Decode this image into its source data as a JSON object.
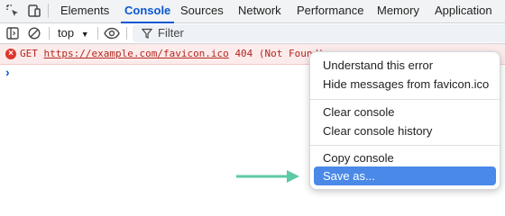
{
  "devtools": {
    "tabs": [
      {
        "label": "Elements"
      },
      {
        "label": "Console"
      },
      {
        "label": "Sources"
      },
      {
        "label": "Network"
      },
      {
        "label": "Performance"
      },
      {
        "label": "Memory"
      },
      {
        "label": "Application"
      }
    ],
    "active_tab": "Console",
    "accent_color": "#0b57d0"
  },
  "toolbar": {
    "context_label": "top",
    "filter_placeholder": "Filter"
  },
  "console": {
    "error": {
      "method": "GET",
      "url": "https://example.com/favicon.ico",
      "status": "404 (Not Found)"
    },
    "prompt": "›"
  },
  "context_menu": {
    "items": [
      {
        "label": "Understand this error"
      },
      {
        "label": "Hide messages from favicon.ico"
      },
      {
        "label": "Clear console"
      },
      {
        "label": "Clear console history"
      },
      {
        "label": "Copy console"
      },
      {
        "label": "Save as..."
      }
    ],
    "highlighted": "Save as...",
    "highlight_color": "#4a89e8"
  },
  "annotation": {
    "arrow_color": "#5cc9a7"
  }
}
